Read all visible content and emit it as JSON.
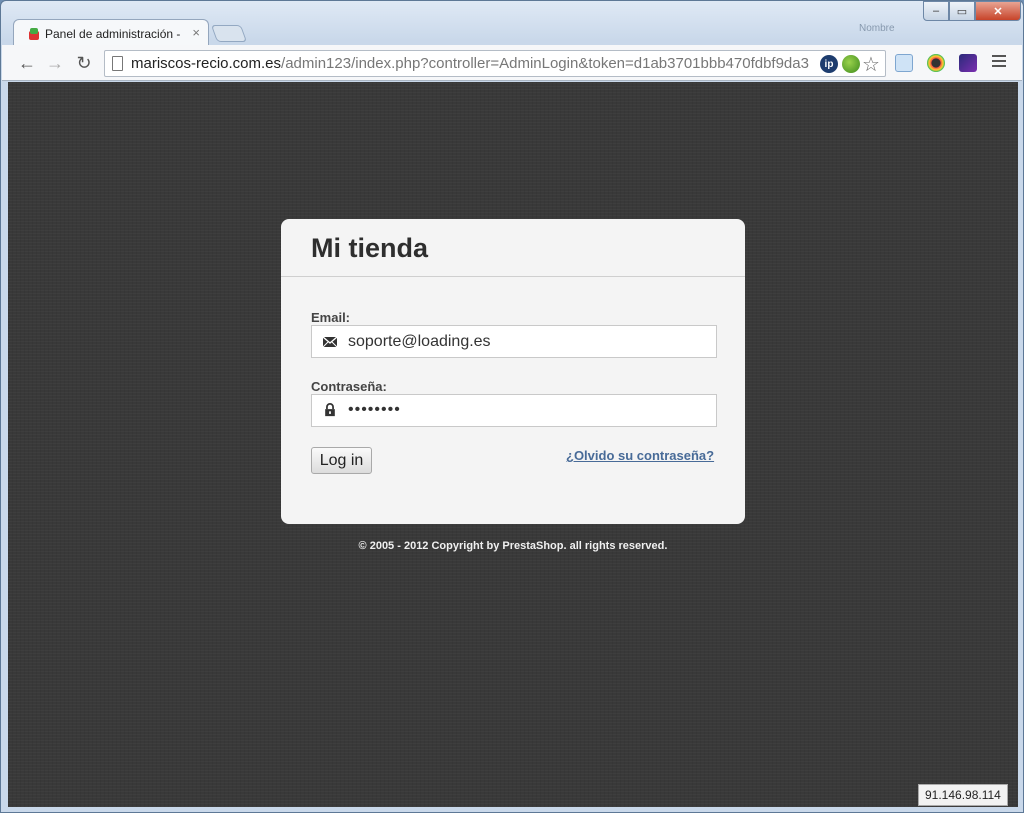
{
  "browser": {
    "tab_title": "Panel de administración - ",
    "tab_close": "×",
    "user_name": "Nombre",
    "window_controls": {
      "minimize": "–",
      "maximize": "▭",
      "close": "✕"
    },
    "nav": {
      "back": "←",
      "forward": "→",
      "reload": "↻"
    },
    "url_host": "mariscos-recio.com.es",
    "url_path": "/admin123/index.php?controller=AdminLogin&token=d1ab3701bbb470fdbf9da3",
    "omnibox_ext_ip": "ip",
    "star": "☆"
  },
  "login": {
    "store_name": "Mi tienda",
    "email_label": "Email:",
    "email_value": "soporte@loading.es",
    "password_label": "Contraseña:",
    "password_value": "••••••••",
    "login_button": "Log in",
    "forgot_link": "¿Olvido su contraseña?"
  },
  "footer": {
    "copyright": "© 2005 - 2012 Copyright by PrestaShop. all rights reserved."
  },
  "ip_address": "91.146.98.114",
  "colors": {
    "page_background": "#393939",
    "card_background": "#f4f4f4",
    "link": "#486b98"
  }
}
